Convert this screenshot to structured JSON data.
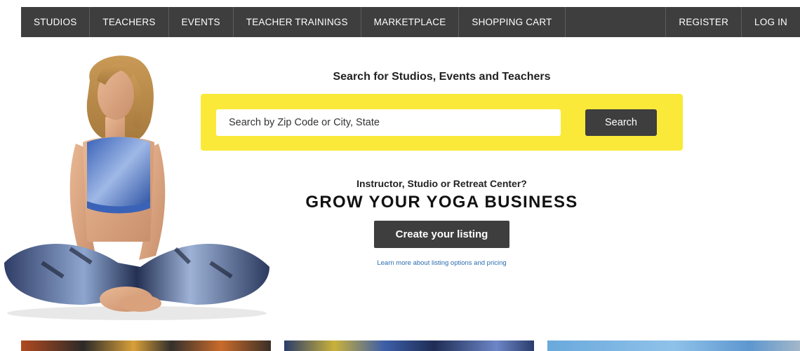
{
  "nav": {
    "left_items": [
      {
        "label": "STUDIOS"
      },
      {
        "label": "TEACHERS"
      },
      {
        "label": "EVENTS"
      },
      {
        "label": "TEACHER TRAININGS"
      },
      {
        "label": "MARKETPLACE"
      },
      {
        "label": "SHOPPING CART"
      }
    ],
    "right_items": [
      {
        "label": "REGISTER"
      },
      {
        "label": "LOG IN"
      }
    ]
  },
  "search": {
    "heading": "Search for Studios, Events and Teachers",
    "placeholder": "Search by Zip Code or City, State",
    "button_label": "Search"
  },
  "promo": {
    "subheading": "Instructor, Studio or Retreat Center?",
    "title": "GROW YOUR YOGA BUSINESS",
    "button_label": "Create your listing",
    "link_label": "Learn more about listing options and pricing"
  },
  "colors": {
    "nav_bg": "#3e3e3e",
    "search_box_bg": "#fbe93a",
    "button_bg": "#3e3e3e",
    "link": "#2b6cb0"
  }
}
